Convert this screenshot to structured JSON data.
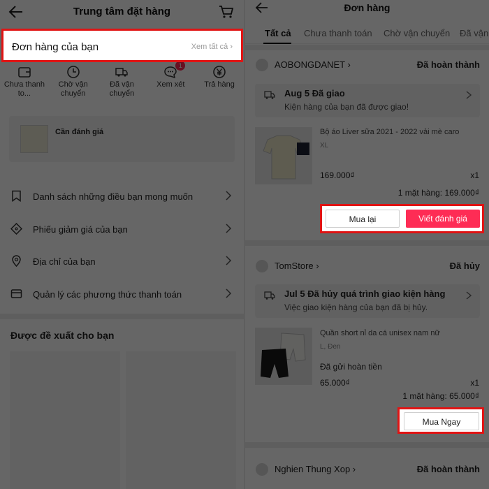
{
  "colors": {
    "accent_red": "#fe2c55",
    "highlight_border": "#e01414"
  },
  "left": {
    "header": {
      "title": "Trung tâm đặt hàng",
      "back_icon": "arrow-left-icon",
      "cart_icon": "cart-icon"
    },
    "orders": {
      "title": "Đơn hàng của bạn",
      "see_all": "Xem tất cả"
    },
    "status_items": [
      {
        "label": "Chưa thanh to...",
        "icon": "wallet-icon"
      },
      {
        "label": "Chờ vận chuyển",
        "icon": "clock-icon"
      },
      {
        "label": "Đã vận chuyển",
        "icon": "truck-icon"
      },
      {
        "label": "Xem xét",
        "icon": "chat-icon",
        "badge": "1"
      },
      {
        "label": "Trả hàng",
        "icon": "yen-icon"
      }
    ],
    "review": {
      "label": "Cần đánh giá"
    },
    "menu": [
      {
        "label": "Danh sách những điều bạn mong muốn",
        "icon": "bookmark-icon"
      },
      {
        "label": "Phiếu giảm giá của bạn",
        "icon": "coupon-icon"
      },
      {
        "label": "Địa chỉ của bạn",
        "icon": "location-icon"
      },
      {
        "label": "Quản lý các phương thức thanh toán",
        "icon": "card-icon"
      }
    ],
    "recommended_title": "Được đề xuất cho bạn"
  },
  "right": {
    "header": {
      "title": "Đơn hàng",
      "back_icon": "arrow-left-icon"
    },
    "tabs": [
      "Tất cả",
      "Chưa thanh toán",
      "Chờ vận chuyển",
      "Đã vận"
    ],
    "orders": [
      {
        "shop": "AOBONGDANET",
        "status": "Đã hoàn thành",
        "ship_date": "Aug 5 Đã giao",
        "ship_note": "Kiện hàng của bạn đã được giao!",
        "product": "Bộ áo Liver sữa 2021 - 2022 vải mè caro",
        "variant": "XL",
        "price": "169.000₫",
        "qty": "x1",
        "total": "1 mặt hàng: 169.000₫",
        "buttons": [
          "Mua lại",
          "Viết đánh giá"
        ]
      },
      {
        "shop": "TomStore",
        "status": "Đã hủy",
        "ship_date": "Jul 5 Đã hủy quá trình giao kiện hàng",
        "ship_note": "Việc giao kiện hàng của bạn đã bị hủy.",
        "product": "Quần short nỉ da cá unisex nam nữ",
        "variant": "L, Đen",
        "refund": "Đã gửi hoàn tiền",
        "price": "65.000₫",
        "qty": "x1",
        "total": "1 mặt hàng: 65.000₫",
        "buttons": [
          "Mua Ngay"
        ]
      },
      {
        "shop": "Nghien Thung Xop",
        "status": "Đã hoàn thành"
      }
    ]
  }
}
